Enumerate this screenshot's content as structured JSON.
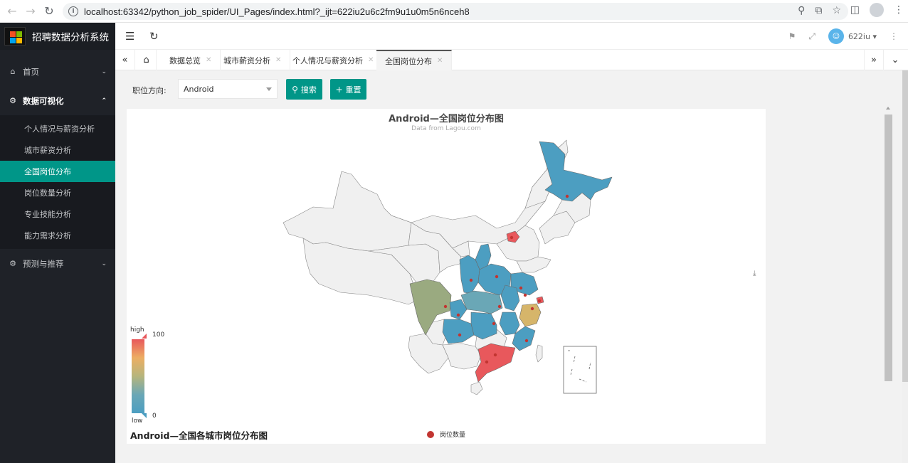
{
  "browser": {
    "url": "localhost:63342/python_job_spider/UI_Pages/index.html?_ijt=622iu2u6c2fm9u1u0m5n6nceh8",
    "back_icon": "arrow-left-icon",
    "forward_icon": "arrow-right-icon",
    "reload_icon": "reload-icon"
  },
  "app": {
    "name": "招聘数据分析系统",
    "user": "622iu"
  },
  "sidebar": {
    "groups": [
      {
        "label": "首页",
        "icon": "home-icon",
        "expanded": false
      },
      {
        "label": "数据可视化",
        "icon": "gear-icon",
        "expanded": true,
        "items": [
          "个人情况与薪资分析",
          "城市薪资分析",
          "全国岗位分布",
          "岗位数量分析",
          "专业技能分析",
          "能力需求分析"
        ],
        "selected": "全国岗位分布"
      },
      {
        "label": "预测与推荐",
        "icon": "gear-icon",
        "expanded": false
      }
    ]
  },
  "tabs": [
    "数据总览",
    "城市薪资分析",
    "个人情况与薪资分析",
    "全国岗位分布"
  ],
  "filter": {
    "label": "职位方向:",
    "value": "Android",
    "search_label": "搜索",
    "reset_label": "重置"
  },
  "chart_data": {
    "type": "map",
    "title": "Android—全国岗位分布图",
    "subtitle": "Data from Lagou.com",
    "footer_title": "Android—全国各城市岗位分布图",
    "legend": [
      "岗位数量"
    ],
    "visual_map": {
      "min": 0,
      "max": 100,
      "text_high": "high",
      "text_low": "low",
      "colors": [
        "#e8585c",
        "#ecae63",
        "#b6b57c",
        "#6aa7b6",
        "#4c9ec1"
      ]
    }
  }
}
